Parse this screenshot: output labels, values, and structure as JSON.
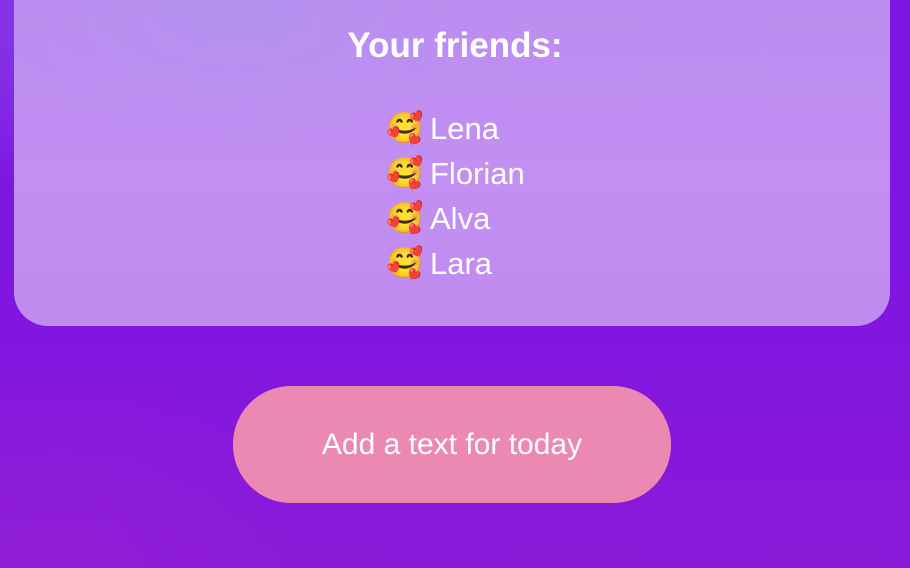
{
  "friends_card": {
    "title": "Your friends:",
    "friends": [
      {
        "icon": "smiling-face-with-hearts-icon",
        "emoji": "🥰",
        "name": "Lena"
      },
      {
        "icon": "smiling-face-with-hearts-icon",
        "emoji": "🥰",
        "name": "Florian"
      },
      {
        "icon": "smiling-face-with-hearts-icon",
        "emoji": "🥰",
        "name": "Alva"
      },
      {
        "icon": "smiling-face-with-hearts-icon",
        "emoji": "🥰",
        "name": "Lara"
      }
    ]
  },
  "actions": {
    "add_text_label": "Add a text for today"
  },
  "colors": {
    "background": "#7f17e2",
    "card": "#c08ef1",
    "button": "#ec89b2",
    "text": "#ffffff"
  }
}
